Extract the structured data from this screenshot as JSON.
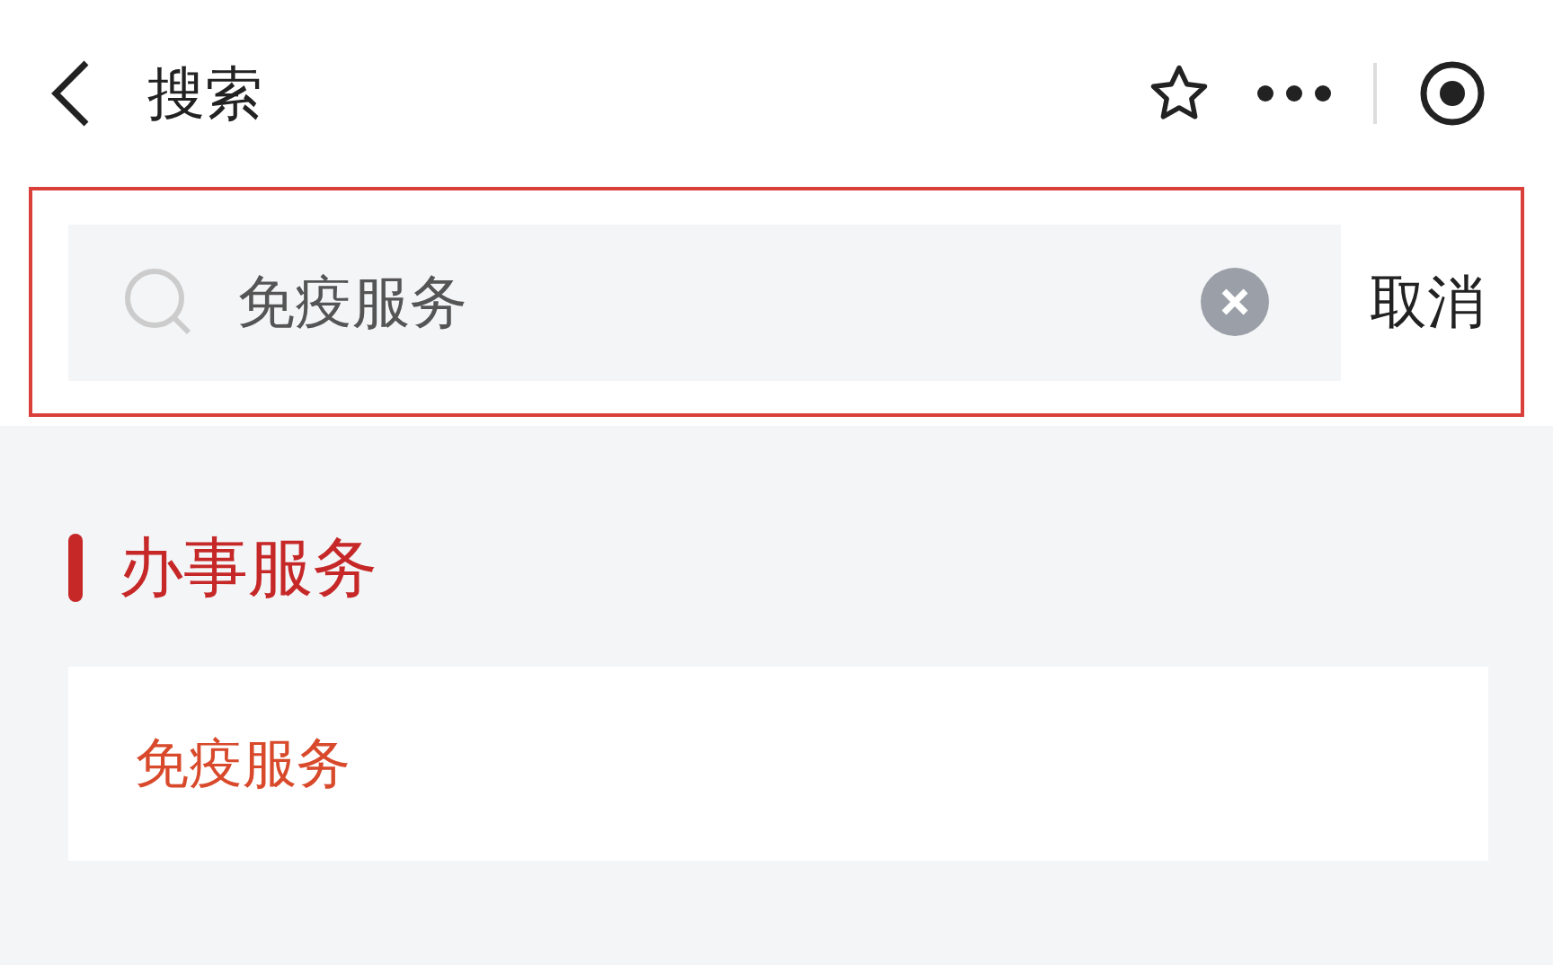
{
  "nav_bar": {
    "title": "搜索"
  },
  "search": {
    "value": "免疫服务",
    "cancel": "取消"
  },
  "section": {
    "title": "办事服务",
    "results": [
      {
        "label": "免疫服务"
      }
    ]
  }
}
